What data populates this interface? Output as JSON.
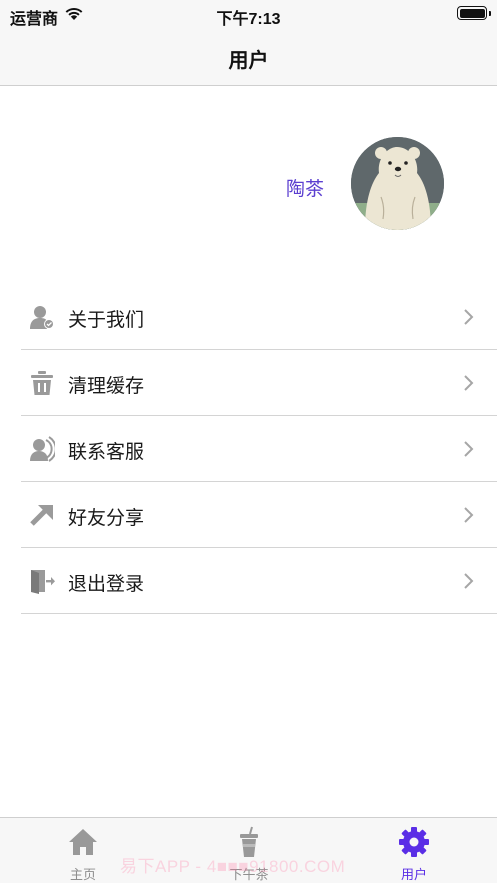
{
  "status_bar": {
    "carrier": "运营商",
    "time": "下午7:13",
    "battery_level": 1.0
  },
  "nav": {
    "title": "用户"
  },
  "profile": {
    "name": "陶茶",
    "name_color": "#5b3fd0"
  },
  "menu": {
    "items": [
      {
        "label": "关于我们",
        "icon": "user-info-icon"
      },
      {
        "label": "清理缓存",
        "icon": "trash-icon"
      },
      {
        "label": "联系客服",
        "icon": "customer-service-icon"
      },
      {
        "label": "好友分享",
        "icon": "share-arrow-icon"
      },
      {
        "label": "退出登录",
        "icon": "logout-door-icon"
      }
    ]
  },
  "tab_bar": {
    "tabs": [
      {
        "label": "主页",
        "icon": "home-icon",
        "active": false
      },
      {
        "label": "下午茶",
        "icon": "drink-cup-icon",
        "active": false
      },
      {
        "label": "用户",
        "icon": "gear-icon",
        "active": true
      }
    ],
    "active_color": "#5a2ee6",
    "inactive_color": "#8e8e8e",
    "watermark": "易下APP - 4■■■91800.COM"
  }
}
